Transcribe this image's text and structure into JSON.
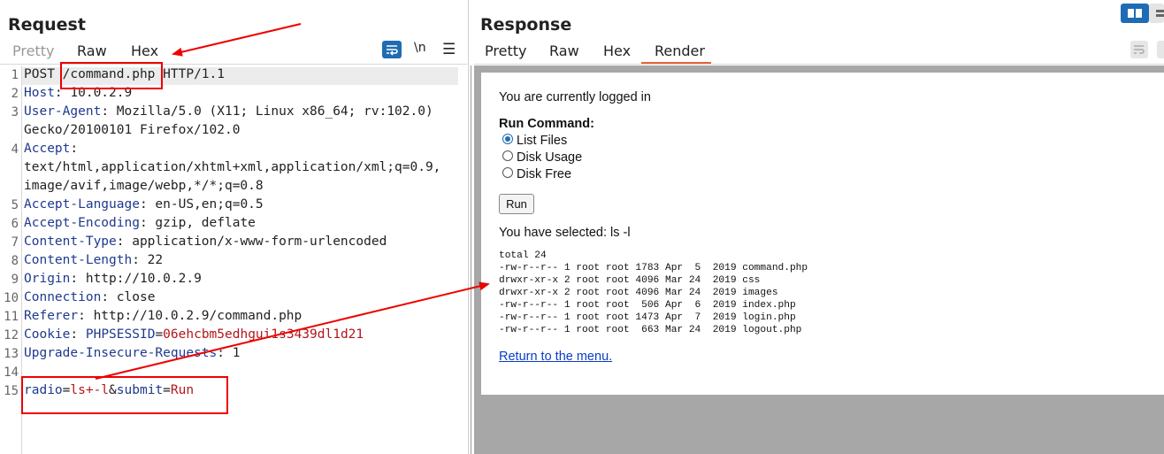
{
  "request": {
    "title": "Request",
    "tabs": [
      "Pretty",
      "Raw",
      "Hex"
    ],
    "controls": {
      "newline": "\\n",
      "menu": "☰"
    },
    "lines": [
      {
        "num": "1",
        "segs": [
          [
            "POST ",
            ""
          ],
          [
            "/command.php",
            ""
          ],
          [
            " HTTP/1.1",
            ""
          ]
        ]
      },
      {
        "num": "2",
        "segs": [
          [
            "Host",
            "hdr"
          ],
          [
            ": 10.0.2.9",
            ""
          ]
        ]
      },
      {
        "num": "3",
        "segs": [
          [
            "User-Agent",
            "hdr"
          ],
          [
            ": Mozilla/5.0 (X11; Linux x86_64; rv:102.0)",
            ""
          ]
        ]
      },
      {
        "num": "",
        "segs": [
          [
            "Gecko/20100101 Firefox/102.0",
            ""
          ]
        ]
      },
      {
        "num": "4",
        "segs": [
          [
            "Accept",
            "hdr"
          ],
          [
            ":",
            ""
          ]
        ]
      },
      {
        "num": "",
        "segs": [
          [
            "text/html,application/xhtml+xml,application/xml;q=0.9,",
            ""
          ]
        ]
      },
      {
        "num": "",
        "segs": [
          [
            "image/avif,image/webp,*/*;q=0.8",
            ""
          ]
        ]
      },
      {
        "num": "5",
        "segs": [
          [
            "Accept-Language",
            "hdr"
          ],
          [
            ": en-US,en;q=0.5",
            ""
          ]
        ]
      },
      {
        "num": "6",
        "segs": [
          [
            "Accept-Encoding",
            "hdr"
          ],
          [
            ": gzip, deflate",
            ""
          ]
        ]
      },
      {
        "num": "7",
        "segs": [
          [
            "Content-Type",
            "hdr"
          ],
          [
            ": application/x-www-form-urlencoded",
            ""
          ]
        ]
      },
      {
        "num": "8",
        "segs": [
          [
            "Content-Length",
            "hdr"
          ],
          [
            ": 22",
            ""
          ]
        ]
      },
      {
        "num": "9",
        "segs": [
          [
            "Origin",
            "hdr"
          ],
          [
            ": http://10.0.2.9",
            ""
          ]
        ]
      },
      {
        "num": "10",
        "segs": [
          [
            "Connection",
            "hdr"
          ],
          [
            ": close",
            ""
          ]
        ]
      },
      {
        "num": "11",
        "segs": [
          [
            "Referer",
            "hdr"
          ],
          [
            ": http://10.0.2.9/command.php",
            ""
          ]
        ]
      },
      {
        "num": "12",
        "segs": [
          [
            "Cookie",
            "hdr"
          ],
          [
            ": ",
            ""
          ],
          [
            "PHPSESSID",
            "hdr"
          ],
          [
            "=",
            ""
          ],
          [
            "06ehcbm5edhgui1s3439dl1d21",
            "red"
          ]
        ]
      },
      {
        "num": "13",
        "segs": [
          [
            "Upgrade-Insecure-Requests",
            "hdr"
          ],
          [
            ": 1",
            ""
          ]
        ]
      },
      {
        "num": "14",
        "segs": []
      },
      {
        "num": "15",
        "segs": [
          [
            "radio",
            "hdr"
          ],
          [
            "=",
            ""
          ],
          [
            "ls+-l",
            "red"
          ],
          [
            "&",
            ""
          ],
          [
            "submit",
            "hdr"
          ],
          [
            "=",
            ""
          ],
          [
            "Run",
            "red"
          ]
        ]
      }
    ]
  },
  "response": {
    "title": "Response",
    "tabs": [
      "Pretty",
      "Raw",
      "Hex",
      "Render"
    ],
    "active_tab": "Render",
    "render": {
      "logged_in": "You are currently logged in",
      "run_command": "Run Command:",
      "options": [
        {
          "label": "List Files",
          "checked": true
        },
        {
          "label": "Disk Usage",
          "checked": false
        },
        {
          "label": "Disk Free",
          "checked": false
        }
      ],
      "run_button": "Run",
      "selected": "You have selected: ls -l",
      "output": [
        "total 24",
        "-rw-r--r-- 1 root root 1783 Apr  5  2019 command.php",
        "drwxr-xr-x 2 root root 4096 Mar 24  2019 css",
        "drwxr-xr-x 2 root root 4096 Mar 24  2019 images",
        "-rw-r--r-- 1 root root  506 Apr  6  2019 index.php",
        "-rw-r--r-- 1 root root 1473 Apr  7  2019 login.php",
        "-rw-r--r-- 1 root root  663 Mar 24  2019 logout.php"
      ],
      "return_link": "Return to the menu."
    }
  },
  "colors": {
    "accent": "#1e6cb4",
    "header_name": "#1f3a8f",
    "value_red": "#b4151a",
    "annotation_red": "#ee0000",
    "active_tab_underline": "#e8643c"
  }
}
